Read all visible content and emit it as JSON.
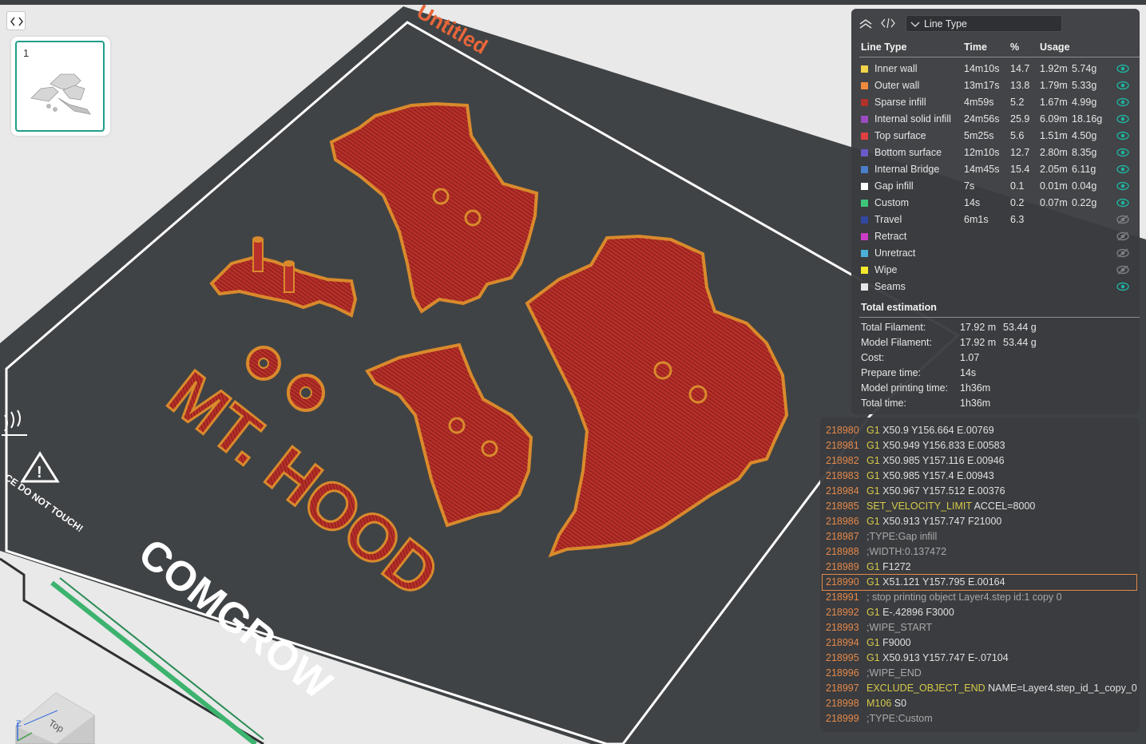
{
  "plate": {
    "name": "Untitled",
    "plate_index": "1",
    "bed_label": "COMGROW",
    "warning_text": "CE DO NOT TOUCH!",
    "model_text": "MT. HOOD"
  },
  "view_cube": {
    "axis_z": "Z",
    "face": "Top"
  },
  "legend": {
    "selector_value": "Line Type",
    "headers": {
      "type": "Line Type",
      "time": "Time",
      "percent": "%",
      "usage": "Usage"
    },
    "rows": [
      {
        "label": "Inner wall",
        "time": "14m10s",
        "percent": "14.7",
        "length": "1.92m",
        "weight": "5.74g",
        "color": "#f2d34a",
        "visible": true
      },
      {
        "label": "Outer wall",
        "time": "13m17s",
        "percent": "13.8",
        "length": "1.79m",
        "weight": "5.33g",
        "color": "#f08a3c",
        "visible": true
      },
      {
        "label": "Sparse infill",
        "time": "4m59s",
        "percent": "5.2",
        "length": "1.67m",
        "weight": "4.99g",
        "color": "#b0322c",
        "visible": true
      },
      {
        "label": "Internal solid infill",
        "time": "24m56s",
        "percent": "25.9",
        "length": "6.09m",
        "weight": "18.16g",
        "color": "#9a4cc0",
        "visible": true
      },
      {
        "label": "Top surface",
        "time": "5m25s",
        "percent": "5.6",
        "length": "1.51m",
        "weight": "4.50g",
        "color": "#e04040",
        "visible": true
      },
      {
        "label": "Bottom surface",
        "time": "12m10s",
        "percent": "12.7",
        "length": "2.80m",
        "weight": "8.35g",
        "color": "#6a5ac8",
        "visible": true
      },
      {
        "label": "Internal Bridge",
        "time": "14m45s",
        "percent": "15.4",
        "length": "2.05m",
        "weight": "6.11g",
        "color": "#4a7ec8",
        "visible": true
      },
      {
        "label": "Gap infill",
        "time": "7s",
        "percent": "0.1",
        "length": "0.01m",
        "weight": "0.04g",
        "color": "#ffffff",
        "visible": true
      },
      {
        "label": "Custom",
        "time": "14s",
        "percent": "0.2",
        "length": "0.07m",
        "weight": "0.22g",
        "color": "#3ec47a",
        "visible": true
      },
      {
        "label": "Travel",
        "time": "6m1s",
        "percent": "6.3",
        "length": "",
        "weight": "",
        "color": "#3248a0",
        "visible": false
      },
      {
        "label": "Retract",
        "time": "",
        "percent": "",
        "length": "",
        "weight": "",
        "color": "#c83cc8",
        "visible": false
      },
      {
        "label": "Unretract",
        "time": "",
        "percent": "",
        "length": "",
        "weight": "",
        "color": "#4ab0d8",
        "visible": false
      },
      {
        "label": "Wipe",
        "time": "",
        "percent": "",
        "length": "",
        "weight": "",
        "color": "#f2e82c",
        "visible": false
      },
      {
        "label": "Seams",
        "time": "",
        "percent": "",
        "length": "",
        "weight": "",
        "color": "#e8e8e8",
        "visible": true
      }
    ],
    "total_title": "Total estimation",
    "totals": [
      {
        "label": "Total Filament:",
        "value": "17.92 m",
        "extra": "53.44 g"
      },
      {
        "label": "Model Filament:",
        "value": "17.92 m",
        "extra": "53.44 g"
      },
      {
        "label": "Cost:",
        "value": "1.07",
        "extra": ""
      },
      {
        "label": "Prepare time:",
        "value": "14s",
        "extra": ""
      },
      {
        "label": "Model printing time:",
        "value": "1h36m",
        "extra": ""
      },
      {
        "label": "Total time:",
        "value": "1h36m",
        "extra": ""
      }
    ]
  },
  "gcode": {
    "selected_line": "218990",
    "lines": [
      {
        "num": "218980",
        "cmd": "G1",
        "args": "X50.9 Y156.664 E.00769",
        "kind": "cmd"
      },
      {
        "num": "218981",
        "cmd": "G1",
        "args": "X50.949 Y156.833 E.00583",
        "kind": "cmd"
      },
      {
        "num": "218982",
        "cmd": "G1",
        "args": "X50.985 Y157.116 E.00946",
        "kind": "cmd"
      },
      {
        "num": "218983",
        "cmd": "G1",
        "args": "X50.985 Y157.4 E.00943",
        "kind": "cmd"
      },
      {
        "num": "218984",
        "cmd": "G1",
        "args": "X50.967 Y157.512 E.00376",
        "kind": "cmd"
      },
      {
        "num": "218985",
        "cmd": "SET_VELOCITY_LIMIT",
        "args": "ACCEL=8000",
        "kind": "cmd"
      },
      {
        "num": "218986",
        "cmd": "G1",
        "args": "X50.913 Y157.747 F21000",
        "kind": "cmd"
      },
      {
        "num": "218987",
        "cmd": "",
        "args": ";TYPE:Gap infill",
        "kind": "comment"
      },
      {
        "num": "218988",
        "cmd": "",
        "args": ";WIDTH:0.137472",
        "kind": "comment"
      },
      {
        "num": "218989",
        "cmd": "G1",
        "args": "F1272",
        "kind": "cmd"
      },
      {
        "num": "218990",
        "cmd": "G1",
        "args": "X51.121 Y157.795 E.00164",
        "kind": "cmd"
      },
      {
        "num": "218991",
        "cmd": "",
        "args": "; stop printing object Layer4.step id:1 copy 0",
        "kind": "comment"
      },
      {
        "num": "218992",
        "cmd": "G1",
        "args": "E-.42896 F3000",
        "kind": "cmd"
      },
      {
        "num": "218993",
        "cmd": "",
        "args": ";WIPE_START",
        "kind": "comment"
      },
      {
        "num": "218994",
        "cmd": "G1",
        "args": "F9000",
        "kind": "cmd"
      },
      {
        "num": "218995",
        "cmd": "G1",
        "args": "X50.913 Y157.747 E-.07104",
        "kind": "cmd"
      },
      {
        "num": "218996",
        "cmd": "",
        "args": ";WIPE_END",
        "kind": "comment"
      },
      {
        "num": "218997",
        "cmd": "EXCLUDE_OBJECT_END",
        "args": "NAME=Layer4.step_id_1_copy_0",
        "kind": "cmd"
      },
      {
        "num": "218998",
        "cmd": "M106",
        "args": "S0",
        "kind": "cmd"
      },
      {
        "num": "218999",
        "cmd": "",
        "args": ";TYPE:Custom",
        "kind": "comment"
      }
    ]
  },
  "colors": {
    "panel_bg": "#3a3c3f",
    "plate_bg": "#404345",
    "model_fill": "#b8302a",
    "model_edge": "#d98a2c",
    "accent_teal": "#1f9e8a",
    "gcode_linenum": "#e4884a",
    "gcode_cmd": "#d7c94a"
  }
}
